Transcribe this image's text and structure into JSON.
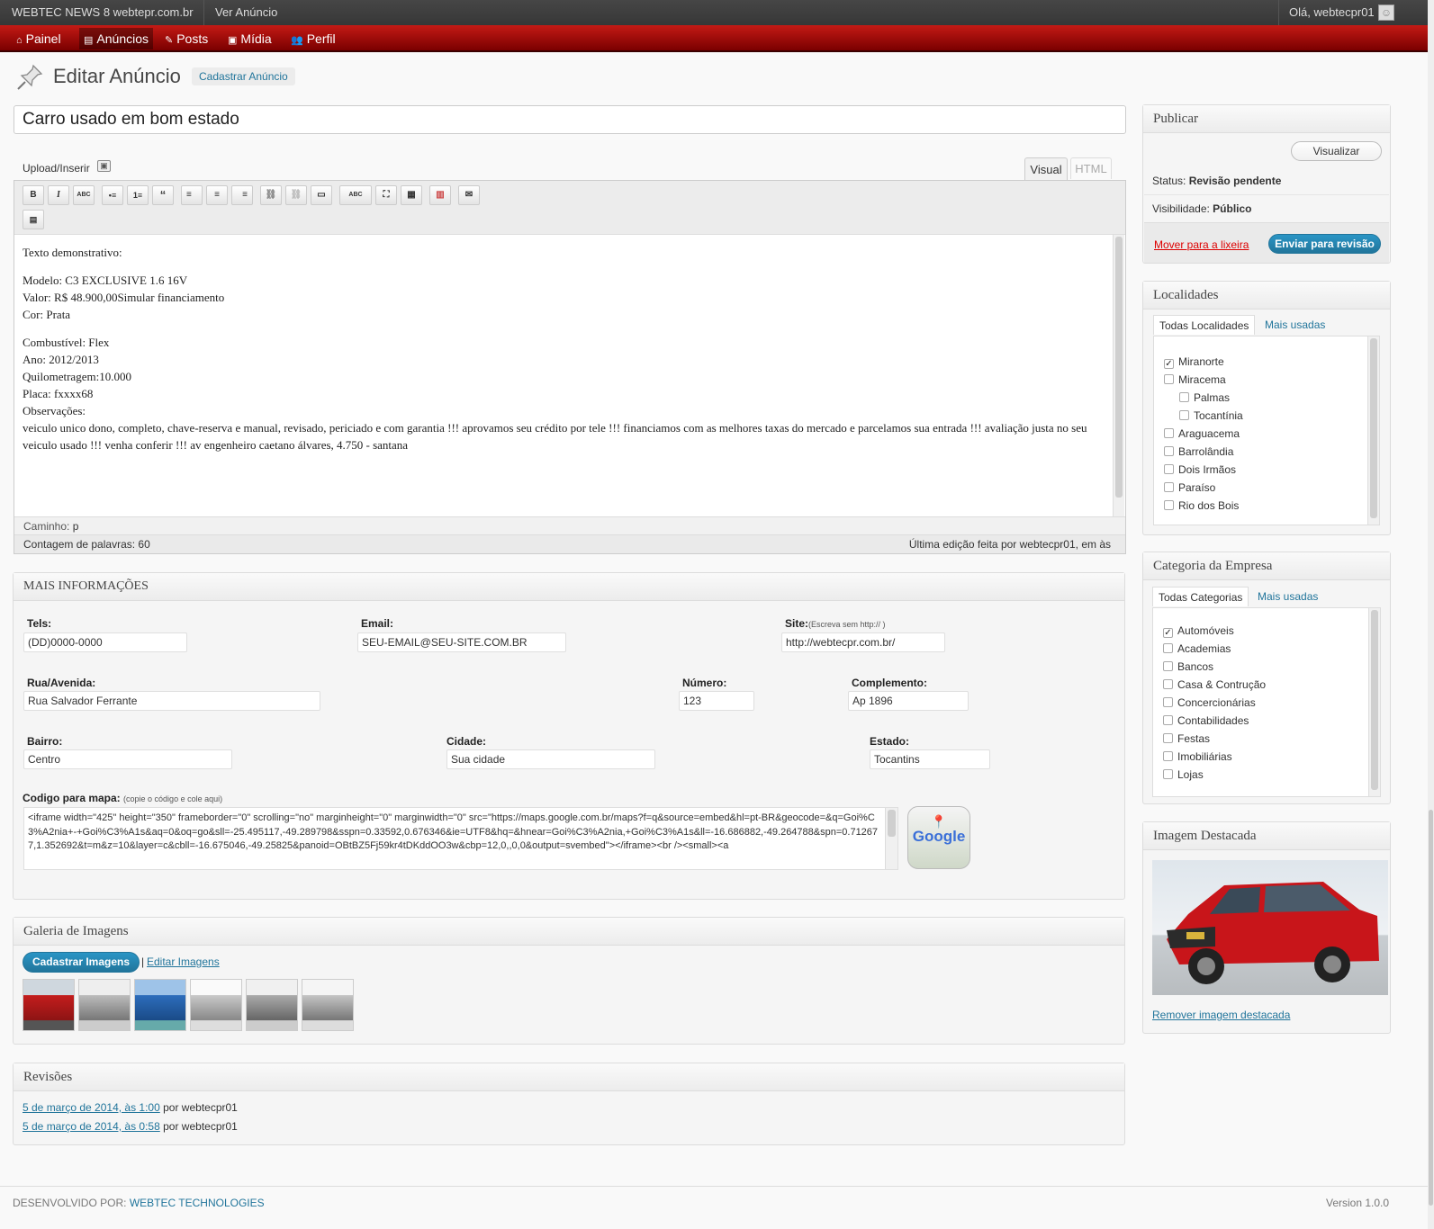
{
  "adminbar": {
    "site": "WEBTEC NEWS 8 webtepr.com.br",
    "view": "Ver Anúncio",
    "greeting": "Olá, webtecpr01"
  },
  "menu": [
    {
      "label": "Painel",
      "icon": "home-icon"
    },
    {
      "label": "Anúncios",
      "icon": "ads-icon"
    },
    {
      "label": "Posts",
      "icon": "pin-icon"
    },
    {
      "label": "Mídia",
      "icon": "media-icon"
    },
    {
      "label": "Perfil",
      "icon": "user-icon"
    }
  ],
  "page": {
    "title": "Editar Anúncio",
    "add_new": "Cadastrar Anúncio",
    "post_title": "Carro usado em bom estado"
  },
  "editor": {
    "upload": "Upload/Inserir",
    "tab_visual": "Visual",
    "tab_html": "HTML",
    "content": [
      "Texto demonstrativo:",
      "Modelo: C3 EXCLUSIVE 1.6 16V",
      "Valor: R$ 48.900,00Simular financiamento",
      "Cor: Prata",
      "Combustível: Flex",
      "Ano: 2012/2013",
      "Quilometragem:10.000",
      "Placa: fxxxx68",
      "Observações:",
      "veiculo unico dono, completo, chave-reserva e manual, revisado, periciado e com garantia !!! aprovamos seu crédito por tele !!! financiamos com as melhores taxas do mercado e parcelamos sua entrada !!! avaliação justa no seu veiculo usado !!! venha conferir !!! av engenheiro caetano álvares, 4.750 - santana"
    ],
    "path_label": "Caminho:",
    "path_value": "p",
    "word_count": "Contagem de palavras: 60",
    "last_edit": "Última edição feita por webtecpr01, em às"
  },
  "toolbar": [
    "B",
    "I",
    "ABC",
    "•≡",
    "1≡",
    "“",
    "≡",
    "≡",
    "≡",
    "⛓",
    "⛓",
    "▭",
    "ABC",
    "⛶",
    "▦",
    "▥",
    "✉"
  ],
  "mais": {
    "title": "MAIS INFORMAÇÕES",
    "tels_label": "Tels:",
    "tels": "(DD)0000-0000",
    "email_label": "Email:",
    "email": "SEU-EMAIL@SEU-SITE.COM.BR",
    "site_label": "Site:",
    "site_hint": "(Escreva sem http:// )",
    "site": "http://webtecpr.com.br/",
    "rua_label": "Rua/Avenida:",
    "rua": "Rua Salvador Ferrante",
    "numero_label": "Número:",
    "numero": "123",
    "compl_label": "Complemento:",
    "compl": "Ap 1896",
    "bairro_label": "Bairro:",
    "bairro": "Centro",
    "cidade_label": "Cidade:",
    "cidade": "Sua cidade",
    "estado_label": "Estado:",
    "estado": "Tocantins",
    "mapa_label": "Codigo para mapa:",
    "mapa_hint": "(copie o código e cole aqui)",
    "mapa_code": "<iframe width=\"425\" height=\"350\" frameborder=\"0\" scrolling=\"no\" marginheight=\"0\" marginwidth=\"0\" src=\"https://maps.google.com.br/maps?f=q&source=embed&hl=pt-BR&geocode=&q=Goi%C3%A2nia+-+Goi%C3%A1s&aq=0&oq=go&sll=-25.495117,-49.289798&sspn=0.33592,0.676346&ie=UTF8&hq=&hnear=Goi%C3%A2nia,+Goi%C3%A1s&ll=-16.686882,-49.264788&spn=0.712677,1.352692&t=m&z=10&layer=c&cbll=-16.675046,-49.25825&panoid=OBtBZ5Fj59kr4tDKddOO3w&cbp=12,0,,0,0&output=svembed\"></iframe><br /><small><a",
    "google": "Google"
  },
  "galeria": {
    "title": "Galeria de Imagens",
    "cadastrar": "Cadastrar Imagens",
    "sep": "|",
    "editar": "Editar Imagens"
  },
  "revisoes": {
    "title": "Revisões",
    "items": [
      {
        "date": "5 de março de 2014, às 1:00",
        "by": "por webtecpr01"
      },
      {
        "date": "5 de março de 2014, às 0:58",
        "by": "por webtecpr01"
      }
    ]
  },
  "publicar": {
    "title": "Publicar",
    "preview": "Visualizar",
    "status_label": "Status:",
    "status": "Revisão pendente",
    "vis_label": "Visibilidade:",
    "vis": "Público",
    "trash": "Mover para a lixeira",
    "submit": "Enviar para revisão"
  },
  "localidades": {
    "title": "Localidades",
    "tab_all": "Todas Localidades",
    "tab_used": "Mais usadas",
    "items": [
      {
        "label": "Miranorte",
        "checked": true,
        "indent": false
      },
      {
        "label": "Miracema",
        "checked": false,
        "indent": false
      },
      {
        "label": "Palmas",
        "checked": false,
        "indent": true
      },
      {
        "label": "Tocantínia",
        "checked": false,
        "indent": true
      },
      {
        "label": "Araguacema",
        "checked": false,
        "indent": false
      },
      {
        "label": "Barrolândia",
        "checked": false,
        "indent": false
      },
      {
        "label": "Dois Irmãos",
        "checked": false,
        "indent": false
      },
      {
        "label": "Paraíso",
        "checked": false,
        "indent": false
      },
      {
        "label": "Rio dos Bois",
        "checked": false,
        "indent": false
      }
    ]
  },
  "categoria": {
    "title": "Categoria da Empresa",
    "tab_all": "Todas Categorias",
    "tab_used": "Mais usadas",
    "items": [
      {
        "label": "Automóveis",
        "checked": true
      },
      {
        "label": "Academias",
        "checked": false
      },
      {
        "label": "Bancos",
        "checked": false
      },
      {
        "label": "Casa & Contrução",
        "checked": false
      },
      {
        "label": "Concercionárias",
        "checked": false
      },
      {
        "label": "Contabilidades",
        "checked": false
      },
      {
        "label": "Festas",
        "checked": false
      },
      {
        "label": "Imobiliárias",
        "checked": false
      },
      {
        "label": "Lojas",
        "checked": false
      }
    ]
  },
  "destacada": {
    "title": "Imagem Destacada",
    "remove": "Remover imagem destacada"
  },
  "footer": {
    "dev_label": "DESENVOLVIDO POR:",
    "dev_link": "WEBTEC TECHNOLOGIES",
    "version": "Version 1.0.0"
  },
  "colors": {
    "menu_red": "#c41a15",
    "link": "#21759b",
    "blue_button": "#21759b"
  }
}
